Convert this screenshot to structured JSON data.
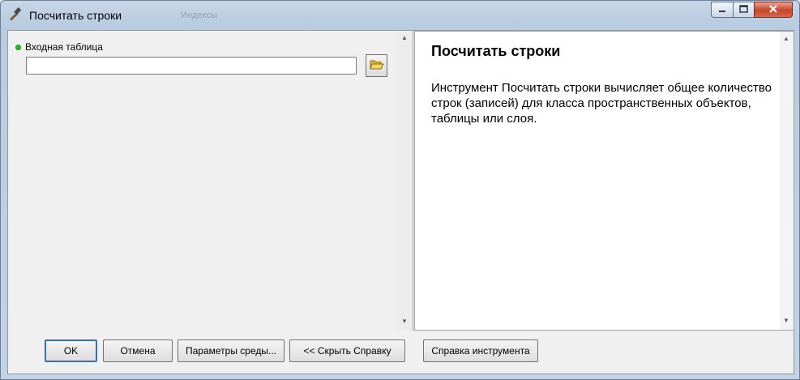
{
  "window": {
    "title": "Посчитать строки",
    "background_ghost_text": "Индексы"
  },
  "parameters": {
    "input_table": {
      "label": "Входная таблица",
      "value": "",
      "placeholder": ""
    }
  },
  "help": {
    "title": "Посчитать строки",
    "body": "Инструмент Посчитать строки вычисляет общее количество строк (записей) для класса пространственных объектов, таблицы или слоя."
  },
  "buttons": {
    "ok": "OK",
    "cancel": "Отмена",
    "env": "Параметры среды...",
    "hide_help": "<< Скрыть Справку",
    "tool_help": "Справка инструмента"
  },
  "icons": {
    "title": "hammer-icon",
    "browse": "open-folder-icon"
  },
  "colors": {
    "required_indicator": "#23c128",
    "close_button": "#c7432a"
  }
}
